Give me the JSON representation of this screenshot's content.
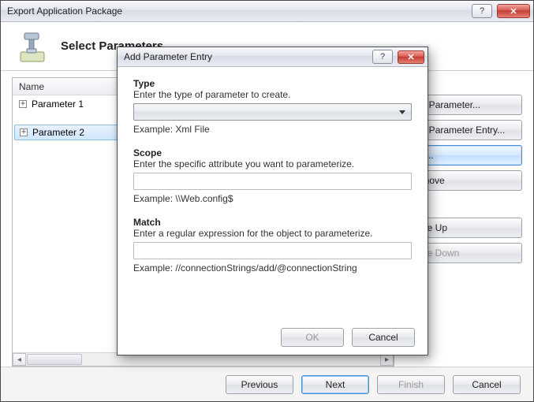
{
  "window": {
    "title": "Export Application Package",
    "help_icon": "help-icon",
    "close_icon": "close-icon"
  },
  "header": {
    "title": "Select Parameters",
    "icon": "package-clamp-icon"
  },
  "list": {
    "column_header": "Name",
    "items": [
      {
        "label": "Parameter 1",
        "selected": false,
        "expanded": false
      },
      {
        "label": "Parameter 2",
        "selected": true,
        "expanded": false
      }
    ]
  },
  "side": {
    "add_parameter": "Add Parameter...",
    "add_entry": "Add Parameter Entry...",
    "edit": "Edit...",
    "remove": "Remove",
    "move_up": "Move Up",
    "move_down": "Move Down"
  },
  "footer": {
    "previous": "Previous",
    "next": "Next",
    "finish": "Finish",
    "cancel": "Cancel"
  },
  "modal": {
    "title": "Add Parameter Entry",
    "type": {
      "label": "Type",
      "desc": "Enter the type of parameter to create.",
      "value": "",
      "hint": "Example: Xml File"
    },
    "scope": {
      "label": "Scope",
      "desc": "Enter the specific attribute you want to parameterize.",
      "value": "",
      "hint": "Example: \\\\Web.config$"
    },
    "match": {
      "label": "Match",
      "desc": "Enter a regular expression for the object to parameterize.",
      "value": "",
      "hint": "Example: //connectionStrings/add/@connectionString"
    },
    "ok": "OK",
    "cancel": "Cancel"
  }
}
